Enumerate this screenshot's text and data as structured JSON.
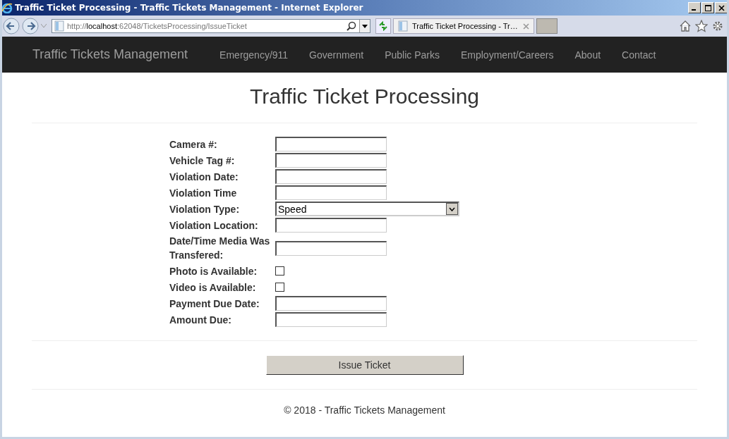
{
  "window": {
    "title": "Traffic Ticket Processing - Traffic Tickets Management - Internet Explorer"
  },
  "address_bar": {
    "url": "http://**localhost**:62048/TicketsProcessing/IssueTicket"
  },
  "tabs": [
    {
      "label": "Traffic Ticket Processing - Tr…",
      "selected": true
    }
  ],
  "navbar": {
    "brand": "Traffic Tickets Management",
    "links": [
      "Emergency/911",
      "Government",
      "Public Parks",
      "Employment/Careers",
      "About",
      "Contact"
    ]
  },
  "page": {
    "heading": "Traffic Ticket Processing",
    "fields": [
      {
        "kind": "text",
        "label": "Camera #:"
      },
      {
        "kind": "text",
        "label": "Vehicle Tag #:"
      },
      {
        "kind": "text",
        "label": "Violation Date:"
      },
      {
        "kind": "text",
        "label": "Violation Time"
      },
      {
        "kind": "select",
        "label": "Violation Type:",
        "value": "Speed"
      },
      {
        "kind": "text",
        "label": "Violation Location:"
      },
      {
        "kind": "text",
        "label": "Date/Time Media Was Transfered:"
      },
      {
        "kind": "checkbox",
        "label": "Photo is Available:",
        "checked": false
      },
      {
        "kind": "checkbox",
        "label": "Video is Available:",
        "checked": false
      },
      {
        "kind": "text",
        "label": "Payment Due Date:"
      },
      {
        "kind": "text",
        "label": "Amount Due:"
      }
    ],
    "submit_button": "Issue Ticket",
    "footer": "© 2018 - Traffic Tickets Management"
  }
}
